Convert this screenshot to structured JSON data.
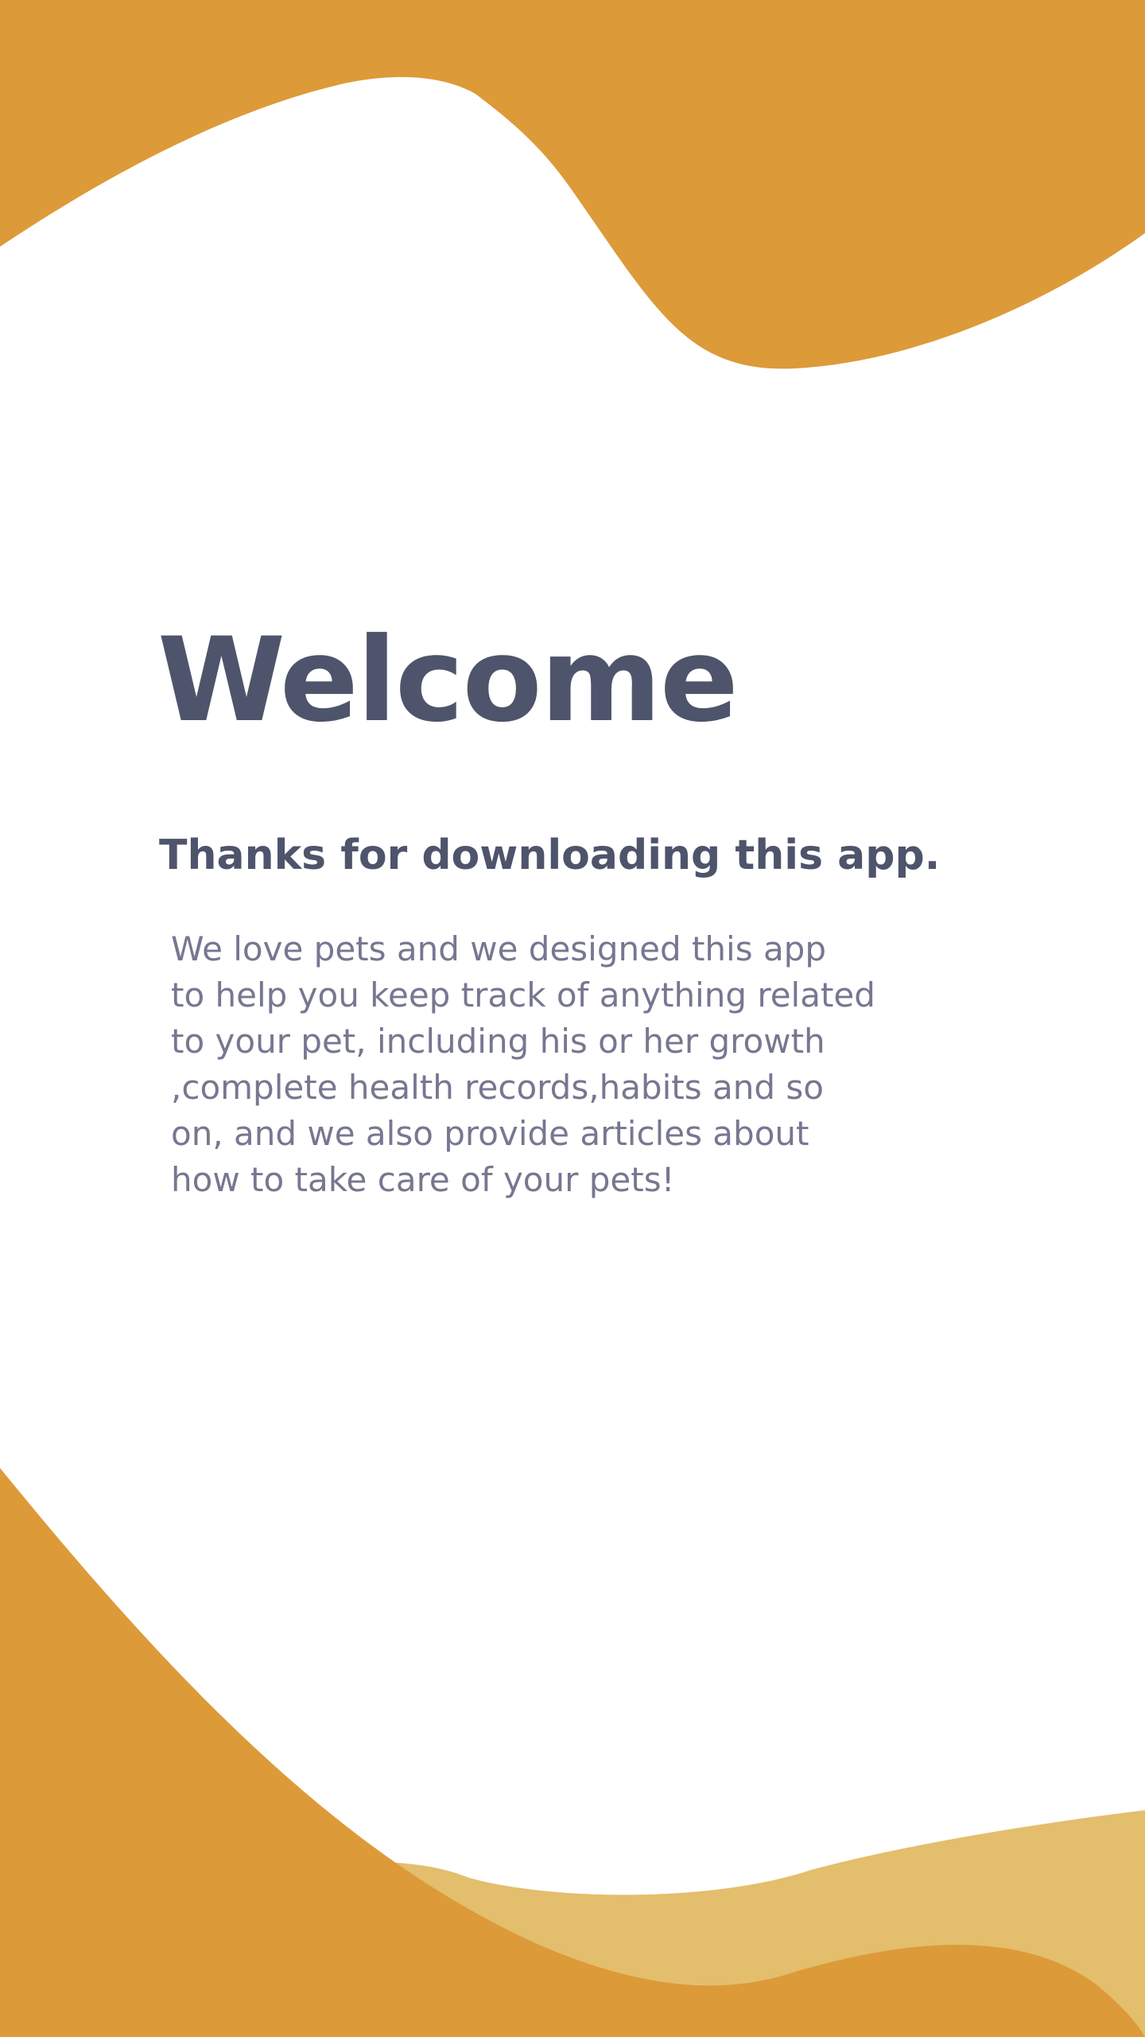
{
  "colors": {
    "background": "#ffffff",
    "accent_orange": "#DD9A38",
    "accent_light": "#E3BE6C",
    "heading_text": "#4E546B",
    "body_text": "#767790"
  },
  "welcome": {
    "title": "Welcome",
    "subtitle": "Thanks for downloading this app.",
    "description": "We love pets and we designed this app\nto help you keep track of anything related\nto your pet, including his or her growth\n,complete health records,habits and so\non, and we also provide articles about\nhow to take care of your pets!"
  }
}
